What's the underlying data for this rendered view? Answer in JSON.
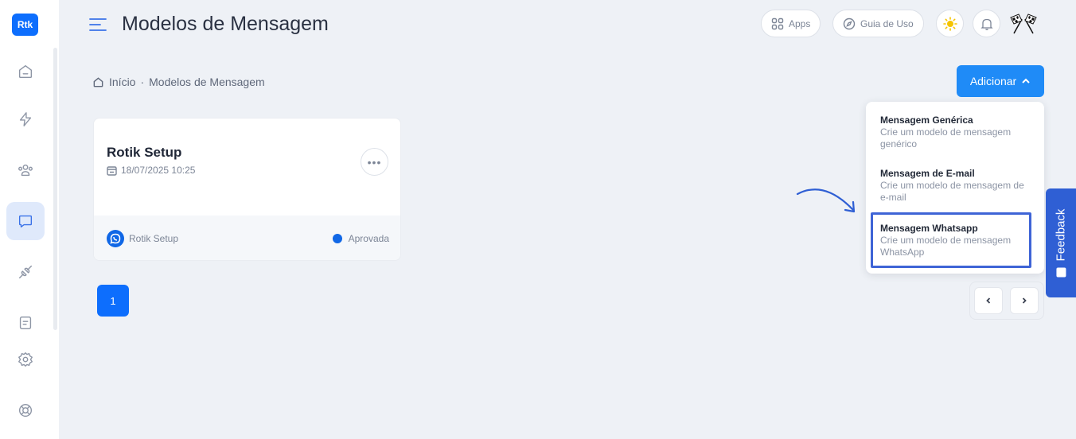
{
  "sidebar": {
    "logo": "Rtk",
    "items": [
      {
        "icon": "home-icon"
      },
      {
        "icon": "bolt-icon"
      },
      {
        "icon": "users-icon"
      },
      {
        "icon": "message-icon",
        "active": true
      },
      {
        "icon": "plug-icon"
      },
      {
        "icon": "document-icon"
      },
      {
        "icon": "settings-icon"
      },
      {
        "icon": "help-icon"
      }
    ]
  },
  "header": {
    "title": "Modelos de Mensagem",
    "apps_label": "Apps",
    "guide_label": "Guia de Uso"
  },
  "breadcrumb": {
    "home": "Início",
    "separator": "·",
    "current": "Modelos de Mensagem"
  },
  "actions": {
    "add_label": "Adicionar"
  },
  "dropdown": {
    "items": [
      {
        "title": "Mensagem Genérica",
        "description": "Crie um modelo de mensagem genérico"
      },
      {
        "title": "Mensagem de E-mail",
        "description": "Crie um modelo de mensagem de e-mail"
      },
      {
        "title": "Mensagem Whatsapp",
        "description": "Crie um modelo de mensagem WhatsApp"
      }
    ]
  },
  "card": {
    "title": "Rotik Setup",
    "date": "18/07/2025 10:25",
    "more": "•••",
    "channel": "Rotik Setup",
    "status": "Aprovada"
  },
  "pagination": {
    "current_page": "1"
  },
  "feedback": {
    "label": "Feedback"
  },
  "colors": {
    "primary": "#0d6efd",
    "accent": "#1f8bf7",
    "feedback": "#2f5fd4",
    "highlight": "#3e64d6"
  }
}
